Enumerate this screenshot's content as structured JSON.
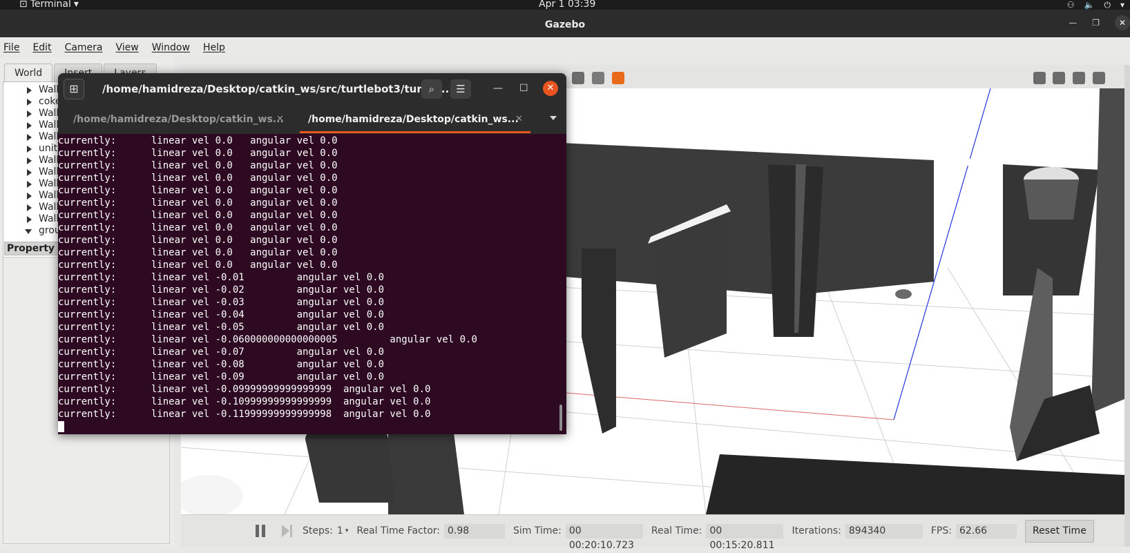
{
  "topbar": {
    "activity": "Terminal",
    "clock": "Apr 1  03:39"
  },
  "gazebo": {
    "title": "Gazebo",
    "menu": [
      "File",
      "Edit",
      "Camera",
      "View",
      "Window",
      "Help"
    ],
    "left_tabs": [
      "World",
      "Insert",
      "Layers"
    ],
    "tree_items": [
      "Wall_",
      "coke",
      "Wall_",
      "Wall_",
      "Wall_",
      "unit_",
      "Wall_",
      "Wall_",
      "Wall_",
      "Wall_",
      "Wall_",
      "Wall_",
      "grou"
    ],
    "property_label": "Property",
    "bottom": {
      "steps_label": "Steps:",
      "steps_value": "1",
      "rtf_label": "Real Time Factor:",
      "rtf_value": "0.98",
      "sim_time_label": "Sim Time:",
      "sim_time_value": "00 00:20:10.723",
      "real_time_label": "Real Time:",
      "real_time_value": "00 00:15:20.811",
      "iterations_label": "Iterations:",
      "iterations_value": "894340",
      "fps_label": "FPS:",
      "fps_value": "62.66",
      "reset_button": "Reset Time"
    }
  },
  "terminal": {
    "title": "/home/hamidreza/Desktop/catkin_ws/src/turtlebot3/turtle...",
    "tabs": [
      {
        "label": "/home/hamidreza/Desktop/catkin_ws...",
        "active": false
      },
      {
        "label": "/home/hamidreza/Desktop/catkin_ws...",
        "active": true
      }
    ],
    "lines": [
      "currently:\tlinear vel 0.0\t angular vel 0.0",
      "currently:\tlinear vel 0.0\t angular vel 0.0",
      "currently:\tlinear vel 0.0\t angular vel 0.0",
      "currently:\tlinear vel 0.0\t angular vel 0.0",
      "currently:\tlinear vel 0.0\t angular vel 0.0",
      "currently:\tlinear vel 0.0\t angular vel 0.0",
      "currently:\tlinear vel 0.0\t angular vel 0.0",
      "currently:\tlinear vel 0.0\t angular vel 0.0",
      "currently:\tlinear vel 0.0\t angular vel 0.0",
      "currently:\tlinear vel 0.0\t angular vel 0.0",
      "currently:\tlinear vel 0.0\t angular vel 0.0",
      "currently:\tlinear vel -0.01\t angular vel 0.0",
      "currently:\tlinear vel -0.02\t angular vel 0.0",
      "currently:\tlinear vel -0.03\t angular vel 0.0",
      "currently:\tlinear vel -0.04\t angular vel 0.0",
      "currently:\tlinear vel -0.05\t angular vel 0.0",
      "currently:\tlinear vel -0.060000000000000005\t angular vel 0.0",
      "currently:\tlinear vel -0.07\t angular vel 0.0",
      "currently:\tlinear vel -0.08\t angular vel 0.0",
      "currently:\tlinear vel -0.09\t angular vel 0.0",
      "currently:\tlinear vel -0.09999999999999999\t angular vel 0.0",
      "currently:\tlinear vel -0.10999999999999999\t angular vel 0.0",
      "currently:\tlinear vel -0.11999999999999998\t angular vel 0.0"
    ]
  },
  "colors": {
    "terminal_bg": "#2d0a22",
    "accent": "#e95420",
    "header_bg": "#2c2c2c"
  }
}
